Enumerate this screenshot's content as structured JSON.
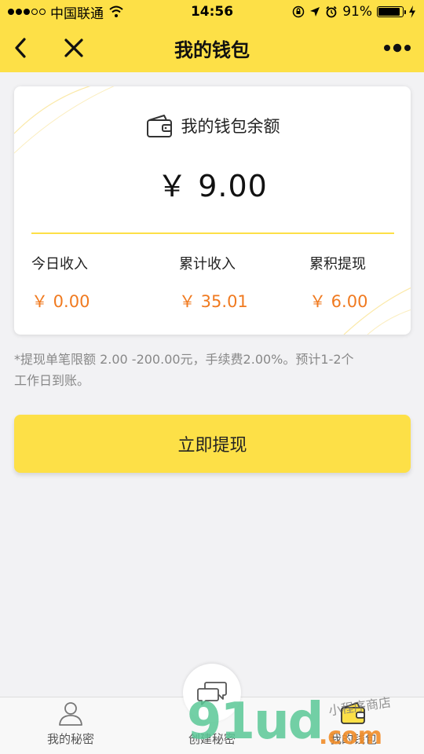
{
  "status_bar": {
    "carrier": "中国联通",
    "time": "14:56",
    "battery_percent": "91%",
    "battery_level": 0.91,
    "icons": [
      "signal-dots-icon",
      "wifi-icon",
      "rotation-lock-icon",
      "location-icon",
      "alarm-icon",
      "battery-icon",
      "charging-icon"
    ]
  },
  "nav": {
    "title": "我的钱包",
    "back_icon": "chevron-left-icon",
    "close_icon": "close-icon",
    "more_icon": "more-icon"
  },
  "wallet_card": {
    "header_label": "我的钱包余额",
    "header_icon": "wallet-icon",
    "balance": "￥ 9.00",
    "stats": [
      {
        "label": "今日收入",
        "value": "￥ 0.00"
      },
      {
        "label": "累计收入",
        "value": "￥ 35.01"
      },
      {
        "label": "累积提现",
        "value": "￥ 6.00"
      }
    ]
  },
  "notice": {
    "line1": "*提现单笔限额 2.00 -200.00元，手续费2.00%。预计1-2个",
    "line2": "工作日到账。"
  },
  "withdraw_button": {
    "label": "立即提现"
  },
  "tab_bar": {
    "tabs": [
      {
        "label": "我的秘密",
        "icon": "user-icon"
      },
      {
        "label": "创建秘密",
        "icon": "chat-bubbles-icon"
      },
      {
        "label": "我的钱包",
        "icon": "wallet-icon"
      }
    ]
  },
  "watermark": {
    "brand": "91ud",
    "suffix": ".com",
    "tag": "小程序商店"
  },
  "colors": {
    "accent_yellow": "#fde047",
    "amount_orange": "#f07a20",
    "background": "#f2f2f4"
  }
}
